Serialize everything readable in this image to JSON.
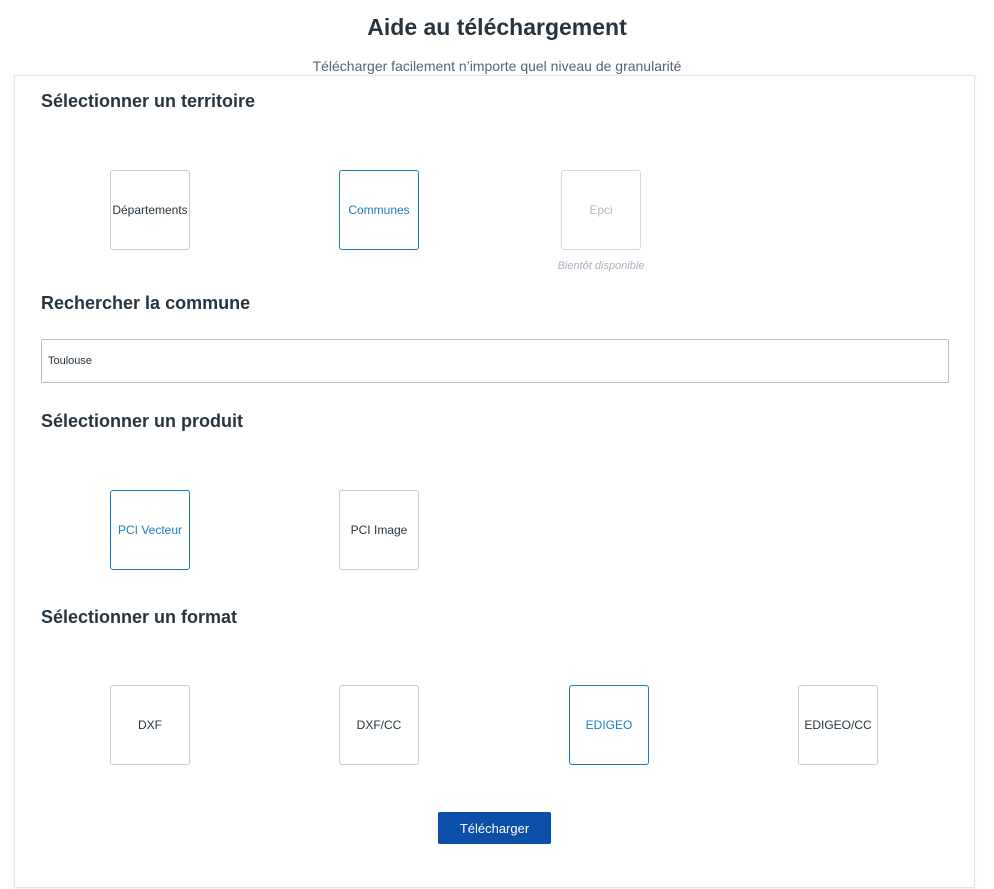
{
  "header": {
    "title": "Aide au téléchargement",
    "subtitle": "Télécharger facilement n’importe quel niveau de granularité"
  },
  "territory": {
    "title": "Sélectionner un territoire",
    "options": [
      {
        "label": "Départements",
        "state": "default"
      },
      {
        "label": "Communes",
        "state": "selected"
      },
      {
        "label": "Epci",
        "state": "disabled",
        "note": "Bientôt disponible"
      }
    ]
  },
  "search": {
    "title": "Rechercher la commune",
    "value": "Toulouse"
  },
  "product": {
    "title": "Sélectionner un produit",
    "options": [
      {
        "label": "PCI Vecteur",
        "state": "selected"
      },
      {
        "label": "PCI Image",
        "state": "default"
      }
    ]
  },
  "format": {
    "title": "Sélectionner un format",
    "options": [
      {
        "label": "DXF",
        "state": "default"
      },
      {
        "label": "DXF/CC",
        "state": "default"
      },
      {
        "label": "EDIGEO",
        "state": "selected"
      },
      {
        "label": "EDIGEO/CC",
        "state": "default"
      }
    ]
  },
  "actions": {
    "download_label": "Télécharger"
  },
  "colors": {
    "accent": "#1c7bbf",
    "primary_button": "#0b4fa8",
    "text": "#26353f",
    "disabled": "#b4bcc6"
  }
}
